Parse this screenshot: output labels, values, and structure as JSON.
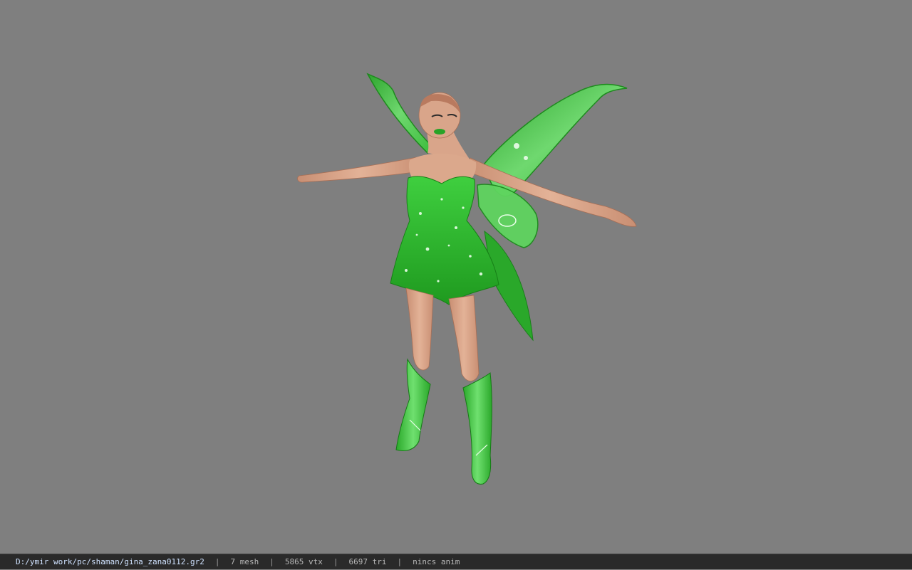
{
  "viewport": {
    "background_color": "#7f7f7f",
    "model_icon": "fairy-character-model"
  },
  "statusbar": {
    "file_path": "D:/ymir work/pc/shaman/gina_zana0112.gr2",
    "separator": "|",
    "mesh_count": "7 mesh",
    "vertex_count": "5865 vtx",
    "triangle_count": "6697 tri",
    "animation": "nincs anim"
  },
  "colors": {
    "skin": "#d9a58a",
    "dress_green": "#2fb52f",
    "wing_green": "#4ccc4c",
    "statusbar_bg": "#2a2a2a"
  }
}
